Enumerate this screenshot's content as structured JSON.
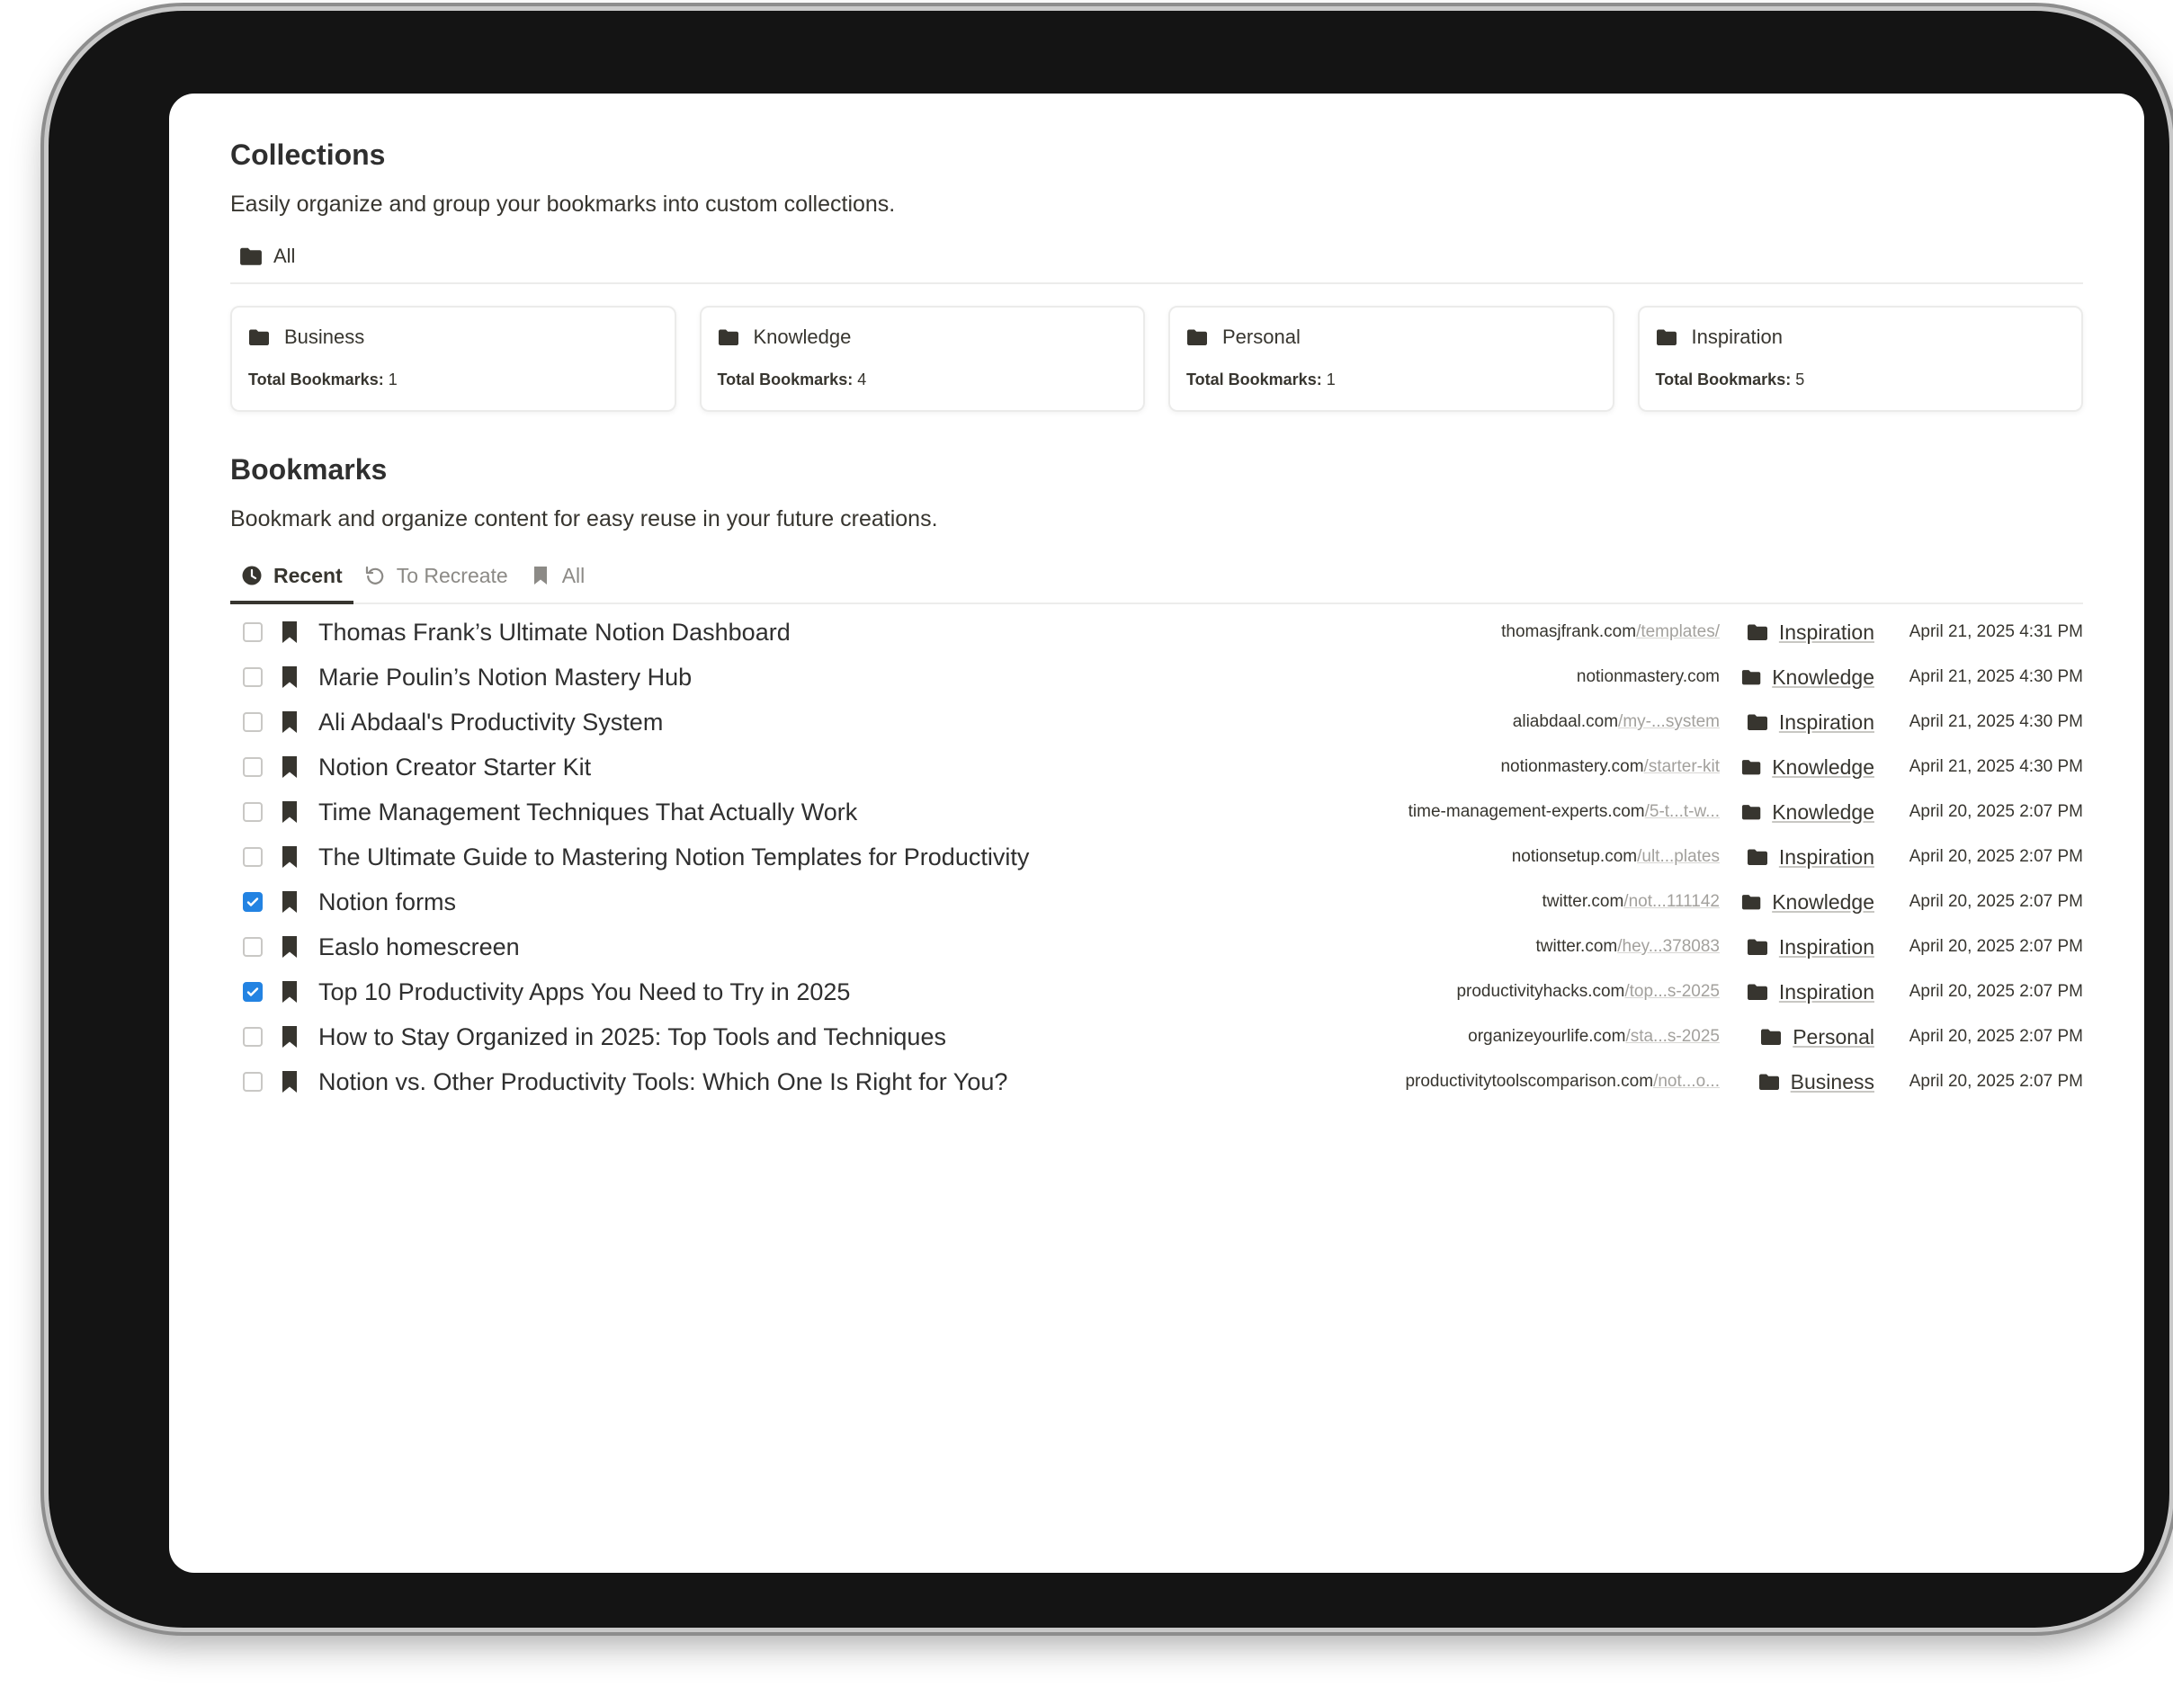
{
  "collections": {
    "title": "Collections",
    "description": "Easily organize and group your bookmarks into custom collections.",
    "view_label": "All",
    "meta_label": "Total Bookmarks:",
    "cards": [
      {
        "name": "Business",
        "count": "1"
      },
      {
        "name": "Knowledge",
        "count": "4"
      },
      {
        "name": "Personal",
        "count": "1"
      },
      {
        "name": "Inspiration",
        "count": "5"
      }
    ]
  },
  "bookmarks": {
    "title": "Bookmarks",
    "description": "Bookmark and organize content for easy reuse in your future creations.",
    "tabs": [
      {
        "label": "Recent",
        "icon": "clock-icon",
        "active": true
      },
      {
        "label": "To Recreate",
        "icon": "refresh-icon",
        "active": false
      },
      {
        "label": "All",
        "icon": "bookmark-icon",
        "active": false
      }
    ],
    "rows": [
      {
        "checked": false,
        "title": "Thomas Frank’s Ultimate Notion Dashboard",
        "domain": "thomasjfrank.com",
        "path": "/templates/",
        "collection": "Inspiration",
        "date": "April 21, 2025 4:31 PM"
      },
      {
        "checked": false,
        "title": "Marie Poulin’s Notion Mastery Hub",
        "domain": "notionmastery.com",
        "path": "",
        "collection": "Knowledge",
        "date": "April 21, 2025 4:30 PM"
      },
      {
        "checked": false,
        "title": "Ali Abdaal's Productivity System",
        "domain": "aliabdaal.com",
        "path": "/my-...system",
        "collection": "Inspiration",
        "date": "April 21, 2025 4:30 PM"
      },
      {
        "checked": false,
        "title": "Notion Creator Starter Kit",
        "domain": "notionmastery.com",
        "path": "/starter-kit",
        "collection": "Knowledge",
        "date": "April 21, 2025 4:30 PM"
      },
      {
        "checked": false,
        "title": "Time Management Techniques That Actually Work",
        "domain": "time-management-experts.com",
        "path": "/5-t...t-w...",
        "collection": "Knowledge",
        "date": "April 20, 2025 2:07 PM"
      },
      {
        "checked": false,
        "title": "The Ultimate Guide to Mastering Notion Templates for Productivity",
        "domain": "notionsetup.com",
        "path": "/ult...plates",
        "collection": "Inspiration",
        "date": "April 20, 2025 2:07 PM"
      },
      {
        "checked": true,
        "title": "Notion forms",
        "domain": "twitter.com",
        "path": "/not...111142",
        "collection": "Knowledge",
        "date": "April 20, 2025 2:07 PM"
      },
      {
        "checked": false,
        "title": "Easlo homescreen",
        "domain": "twitter.com",
        "path": "/hey...378083",
        "collection": "Inspiration",
        "date": "April 20, 2025 2:07 PM"
      },
      {
        "checked": true,
        "title": "Top 10 Productivity Apps You Need to Try in 2025",
        "domain": "productivityhacks.com",
        "path": "/top...s-2025",
        "collection": "Inspiration",
        "date": "April 20, 2025 2:07 PM"
      },
      {
        "checked": false,
        "title": "How to Stay Organized in 2025: Top Tools and Techniques",
        "domain": "organizeyourlife.com",
        "path": "/sta...s-2025",
        "collection": "Personal",
        "date": "April 20, 2025 2:07 PM"
      },
      {
        "checked": false,
        "title": "Notion vs. Other Productivity Tools: Which One Is Right for You?",
        "domain": "productivitytoolscomparison.com",
        "path": "/not...o...",
        "collection": "Business",
        "date": "April 20, 2025 2:07 PM"
      }
    ]
  },
  "colors": {
    "accent_checkbox": "#2383e2",
    "text": "#37352f",
    "muted": "#a3a19d",
    "device_frame": "#141414"
  }
}
